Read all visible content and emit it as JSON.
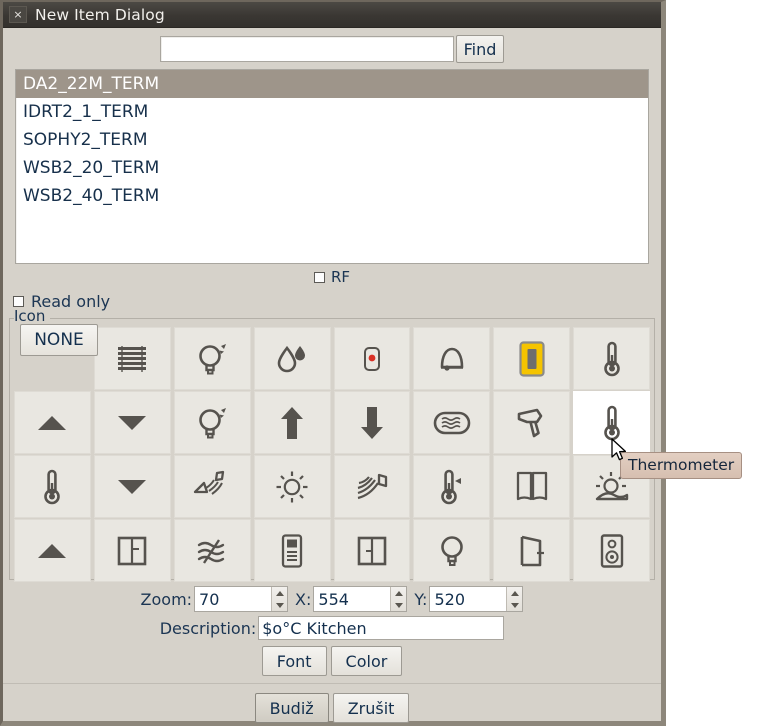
{
  "window": {
    "title": "New Item Dialog",
    "close_label": "×"
  },
  "search": {
    "value": "",
    "placeholder": "",
    "find_label": "Find"
  },
  "list": {
    "items": [
      {
        "label": "DA2_22M_TERM",
        "selected": true
      },
      {
        "label": "IDRT2_1_TERM",
        "selected": false
      },
      {
        "label": "SOPHY2_TERM",
        "selected": false
      },
      {
        "label": "WSB2_20_TERM",
        "selected": false
      },
      {
        "label": "WSB2_40_TERM",
        "selected": false
      }
    ]
  },
  "options": {
    "rf_label": "RF",
    "rf_checked": false,
    "readonly_label": "Read only",
    "readonly_checked": false
  },
  "icon_group": {
    "legend": "Icon",
    "none_label": "NONE",
    "selected_index": 15,
    "hovered_index": 15,
    "tooltip": "Thermometer",
    "icons": [
      {
        "name": "blinds-icon",
        "slot": 1
      },
      {
        "name": "lightbulb-rays-icon",
        "slot": 2
      },
      {
        "name": "water-drops-icon",
        "slot": 3
      },
      {
        "name": "smoke-detector-icon",
        "slot": 4
      },
      {
        "name": "bell-icon",
        "slot": 5
      },
      {
        "name": "yellow-switch-icon",
        "slot": 6
      },
      {
        "name": "thermometer-icon",
        "slot": 7
      },
      {
        "name": "arrow-up-triangle-icon",
        "slot": 8
      },
      {
        "name": "arrow-down-triangle-icon",
        "slot": 9
      },
      {
        "name": "lightbulb-rays-icon",
        "slot": 10
      },
      {
        "name": "arrow-up-icon",
        "slot": 11
      },
      {
        "name": "arrow-down-icon",
        "slot": 12
      },
      {
        "name": "heater-icon",
        "slot": 13
      },
      {
        "name": "hairdryer-icon",
        "slot": 14
      },
      {
        "name": "thermometer-icon",
        "slot": 15
      },
      {
        "name": "thermometer-icon",
        "slot": 16
      },
      {
        "name": "arrow-down-triangle-icon",
        "slot": 17
      },
      {
        "name": "speaker-waves-icon",
        "slot": 18
      },
      {
        "name": "sun-icon",
        "slot": 19
      },
      {
        "name": "motion-sensor-icon",
        "slot": 20
      },
      {
        "name": "thermostat-icon",
        "slot": 21
      },
      {
        "name": "window-open-icon",
        "slot": 22
      },
      {
        "name": "sunrise-icon",
        "slot": 23
      },
      {
        "name": "arrow-up-triangle-icon",
        "slot": 24
      },
      {
        "name": "window-icon",
        "slot": 25
      },
      {
        "name": "waves-icon",
        "slot": 26
      },
      {
        "name": "remote-control-icon",
        "slot": 27
      },
      {
        "name": "window-panel-icon",
        "slot": 28
      },
      {
        "name": "bulb-icon",
        "slot": 29
      },
      {
        "name": "door-icon",
        "slot": 30
      },
      {
        "name": "speaker-icon",
        "slot": 31
      }
    ]
  },
  "form": {
    "zoom_label": "Zoom:",
    "zoom_value": "70",
    "x_label": "X:",
    "x_value": "554",
    "y_label": "Y:",
    "y_value": "520",
    "description_label": "Description:",
    "description_value": "$o°C Kitchen"
  },
  "buttons": {
    "font": "Font",
    "color": "Color",
    "ok": "Budiž",
    "cancel": "Zrušit"
  }
}
